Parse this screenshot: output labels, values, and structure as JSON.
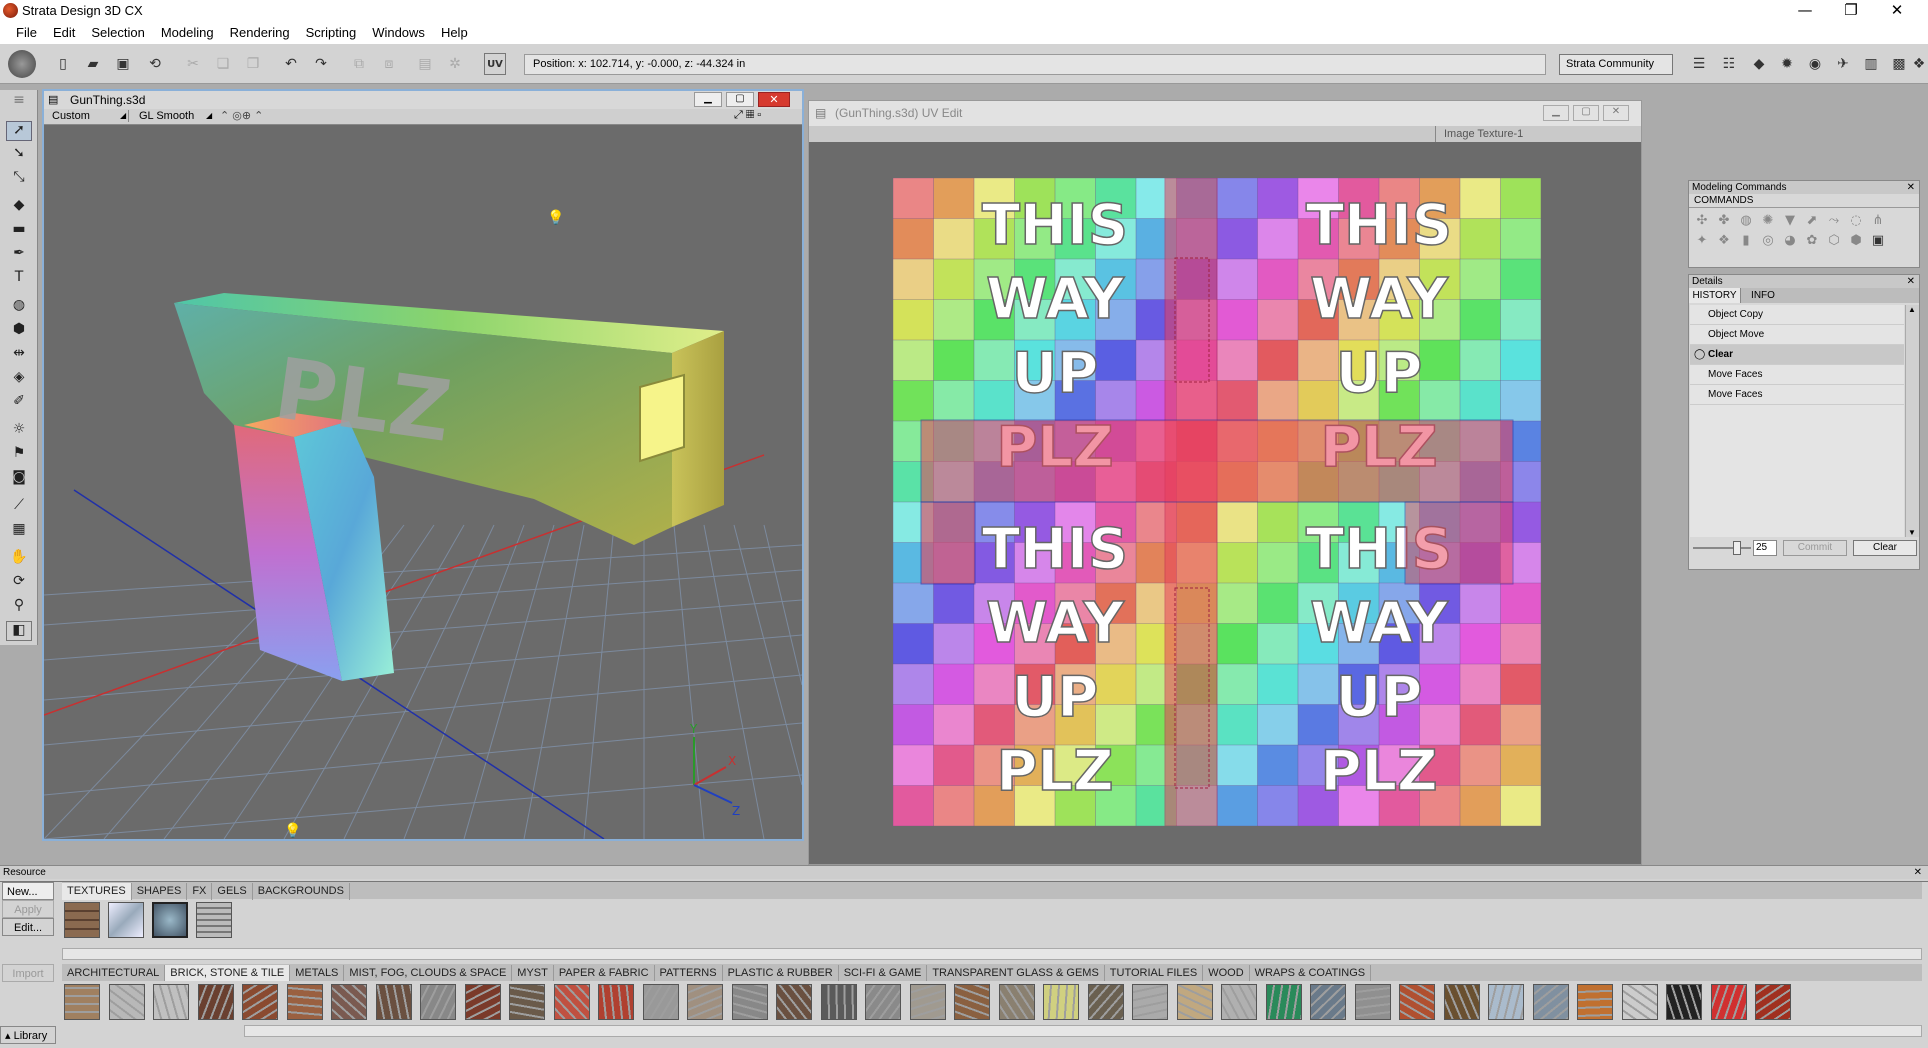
{
  "app": {
    "title": "Strata Design 3D CX",
    "minimize": "—",
    "restore": "❐",
    "close": "✕"
  },
  "menu": [
    "File",
    "Edit",
    "Selection",
    "Modeling",
    "Rendering",
    "Scripting",
    "Windows",
    "Help"
  ],
  "toolbar": {
    "position": "Position:  x: 102.714,  y: -0.000,  z: -44.324 in",
    "community": "Strata Community",
    "uv_label": "UV"
  },
  "view3d": {
    "title": "GunThing.s3d",
    "camera": "Custom",
    "render_mode": "GL Smooth"
  },
  "uv_editor": {
    "title": "(GunThing.s3d) UV Edit",
    "texture": "Image Texture-1",
    "words": [
      "THIS",
      "WAY",
      "UP",
      "PLZ"
    ]
  },
  "viewport_texts": {
    "plz": "PLZ"
  },
  "axes": {
    "x": "X",
    "y": "Y",
    "z": "Z"
  },
  "modeling_commands": {
    "title": "Modeling Commands",
    "tab": "COMMANDS"
  },
  "details": {
    "title": "Details",
    "tabs": [
      "HISTORY",
      "INFO"
    ],
    "history": [
      "Object Copy",
      "Object Move",
      "Clear",
      "Move Faces",
      "Move Faces"
    ],
    "selected_index": 2,
    "slider_value": "25",
    "commit_label": "Commit",
    "clear_label": "Clear"
  },
  "resource": {
    "title": "Resource",
    "tabs": [
      "TEXTURES",
      "SHAPES",
      "FX",
      "GELS",
      "BACKGROUNDS"
    ],
    "buttons": [
      "New...",
      "Apply",
      "Edit...",
      "Import"
    ],
    "library_label": "Library",
    "categories": [
      "ARCHITECTURAL",
      "BRICK, STONE & TILE",
      "METALS",
      "MIST, FOG, CLOUDS & SPACE",
      "MYST",
      "PAPER & FABRIC",
      "PATTERNS",
      "PLASTIC & RUBBER",
      "SCI-FI & GAME",
      "TRANSPARENT GLASS & GEMS",
      "TUTORIAL FILES",
      "WOOD",
      "WRAPS & COATINGS"
    ],
    "active_category": 1
  },
  "colors": {
    "accent": "#8ab0d8",
    "selection": "#e8405a",
    "panel": "#d3d3d3"
  }
}
